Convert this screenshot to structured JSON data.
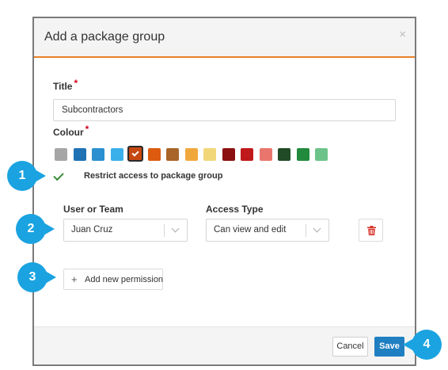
{
  "dialog": {
    "title": "Add a package group",
    "close_glyph": "×"
  },
  "title_field": {
    "label": "Title",
    "required_mark": "*",
    "value": "Subcontractors"
  },
  "colour_field": {
    "label": "Colour",
    "required_mark": "*",
    "selected_index": 4,
    "swatches": [
      "#a6a6a6",
      "#1f72b4",
      "#2b8fd0",
      "#3ab0ea",
      "#c64710",
      "#dc5b0f",
      "#a8652a",
      "#f0a83c",
      "#f2d778",
      "#8c1010",
      "#c0191b",
      "#e8766c",
      "#214b26",
      "#218a3c",
      "#6cc48a"
    ]
  },
  "restrict": {
    "checked": true,
    "label": "Restrict access to package group"
  },
  "permissions": {
    "user_label": "User or Team",
    "access_label": "Access Type",
    "rows": [
      {
        "user": "Juan Cruz",
        "access": "Can view and edit"
      }
    ],
    "add_label": "Add new permission",
    "add_glyph": "+"
  },
  "footer": {
    "cancel_label": "Cancel",
    "save_label": "Save"
  },
  "callouts": [
    "1",
    "2",
    "3",
    "4"
  ],
  "colors": {
    "accent": "#e8822a",
    "primary_button": "#1f7fc1",
    "callout": "#1aa3e0",
    "danger_icon": "#d9342b",
    "check": "#3a8d3a"
  }
}
